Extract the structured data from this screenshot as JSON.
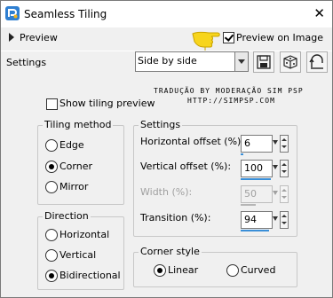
{
  "window": {
    "title": "Seamless Tiling",
    "close_glyph": "✕",
    "app_icon": "psp-app-icon"
  },
  "toolbar": {
    "preview_label": "Preview",
    "preview_on_image_label": "Preview on Image",
    "preview_on_image_checked": true,
    "settings_label": "Settings",
    "settings_value": "Side by side",
    "buttons": [
      "save-preset-icon",
      "randomize-icon",
      "reset-icon"
    ]
  },
  "translation": {
    "line1": "TRADUÇÃO BY MODERAÇÃO SIM PSP",
    "line2": "HTTP://SIMPSP.COM"
  },
  "show_tiling_preview": {
    "label": "Show tiling preview",
    "checked": false
  },
  "tiling_method": {
    "title": "Tiling method",
    "options": [
      "Edge",
      "Corner",
      "Mirror"
    ],
    "selected": "Corner"
  },
  "direction": {
    "title": "Direction",
    "options": [
      "Horizontal",
      "Vertical",
      "Bidirectional"
    ],
    "selected": "Bidirectional"
  },
  "settings": {
    "title": "Settings",
    "horizontal_offset": {
      "label": "Horizontal offset (%):",
      "value": "6",
      "fill": 0.06,
      "enabled": true
    },
    "vertical_offset": {
      "label": "Vertical offset (%):",
      "value": "100",
      "fill": 1.0,
      "enabled": true
    },
    "width": {
      "label": "Width (%):",
      "value": "50",
      "fill": 0.5,
      "enabled": false
    },
    "transition": {
      "label": "Transition (%):",
      "value": "94",
      "fill": 0.94,
      "enabled": true
    }
  },
  "corner_style": {
    "title": "Corner style",
    "options": [
      "Linear",
      "Curved"
    ],
    "selected": "Linear"
  },
  "colors": {
    "accent": "#3a8fd8",
    "hand": "#f7d51d"
  }
}
